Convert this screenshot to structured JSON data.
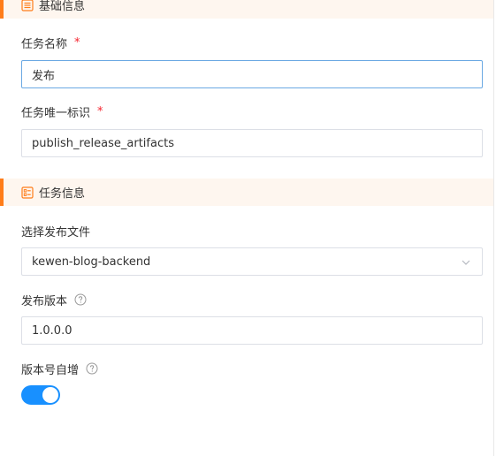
{
  "sections": {
    "basic": {
      "title": "基础信息",
      "icon": "list-document-icon"
    },
    "task": {
      "title": "任务信息",
      "icon": "checklist-icon"
    }
  },
  "fields": {
    "task_name": {
      "label": "任务名称",
      "required_mark": "*",
      "value": "发布"
    },
    "task_id": {
      "label": "任务唯一标识",
      "required_mark": "*",
      "value": "publish_release_artifacts"
    },
    "publish_file": {
      "label": "选择发布文件",
      "value": "kewen-blog-backend",
      "arrow_icon": "chevron-down-icon"
    },
    "publish_version": {
      "label": "发布版本",
      "help_icon": "question-circle-icon",
      "value": "1.0.0.0"
    },
    "auto_increment": {
      "label": "版本号自增",
      "help_icon": "question-circle-icon",
      "enabled": true
    }
  },
  "colors": {
    "accent": "#ff7d1a",
    "section_bg": "#fef6ef",
    "required": "#f5222d",
    "switch_on": "#1890ff",
    "focus_border": "#6ba9e3"
  }
}
